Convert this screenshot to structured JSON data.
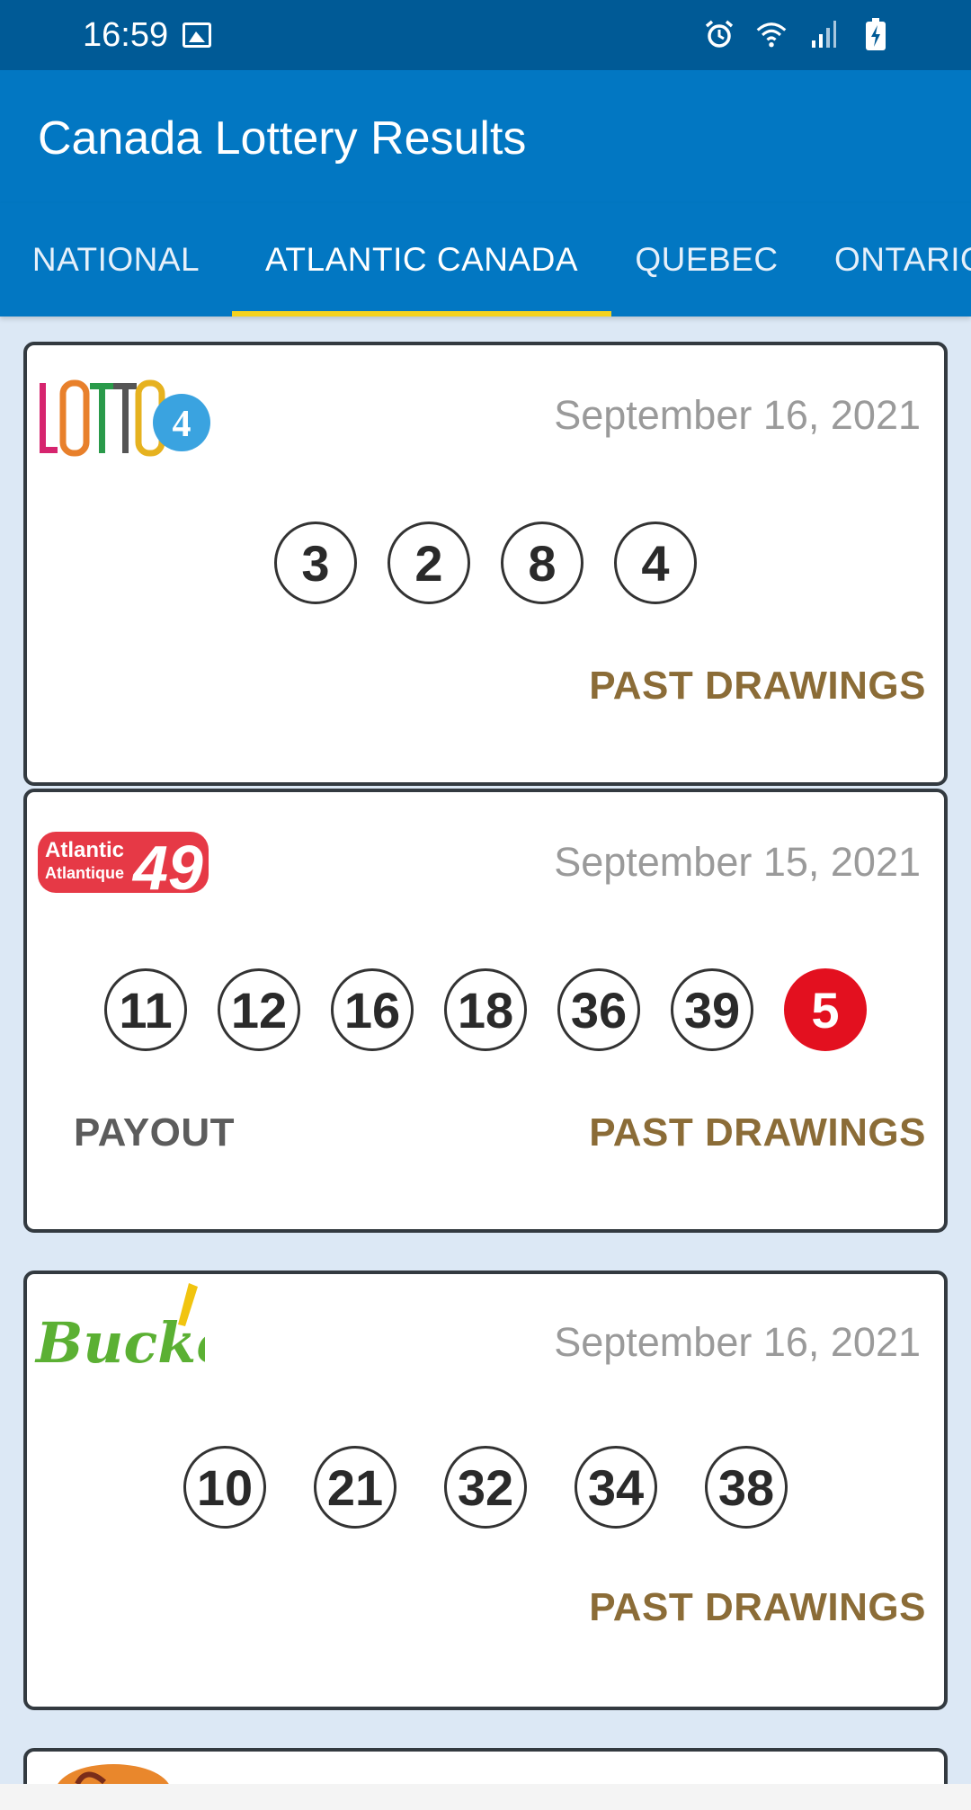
{
  "status_bar": {
    "time": "16:59",
    "icons": [
      "gallery-icon",
      "alarm-icon",
      "wifi-icon",
      "signal-icon",
      "battery-icon"
    ]
  },
  "app_bar": {
    "title": "Canada Lottery Results"
  },
  "tabs": [
    {
      "label": "NATIONAL",
      "active": false
    },
    {
      "label": "ATLANTIC CANADA",
      "active": true
    },
    {
      "label": "QUEBEC",
      "active": false
    },
    {
      "label": "ONTARIO",
      "active": false
    }
  ],
  "cards": [
    {
      "logo_text": "LOTTO 4",
      "date": "September 16, 2021",
      "numbers": [
        "3",
        "2",
        "8",
        "4"
      ],
      "past_label": "PAST DRAWINGS"
    },
    {
      "logo_text": "Atlantic Atlantique 49",
      "date": "September 15, 2021",
      "numbers": [
        "11",
        "12",
        "16",
        "18",
        "36",
        "39"
      ],
      "bonus": "5",
      "payout_label": "PAYOUT",
      "past_label": "PAST DRAWINGS"
    },
    {
      "logo_text": "Bucko",
      "date": "September 16, 2021",
      "numbers": [
        "10",
        "21",
        "32",
        "34",
        "38"
      ],
      "past_label": "PAST DRAWINGS"
    }
  ],
  "colors": {
    "status_bar": "#005a96",
    "primary": "#0277c2",
    "indicator": "#f4d21f",
    "bonus": "#e3101f",
    "past_drawings": "#8b6c37"
  }
}
